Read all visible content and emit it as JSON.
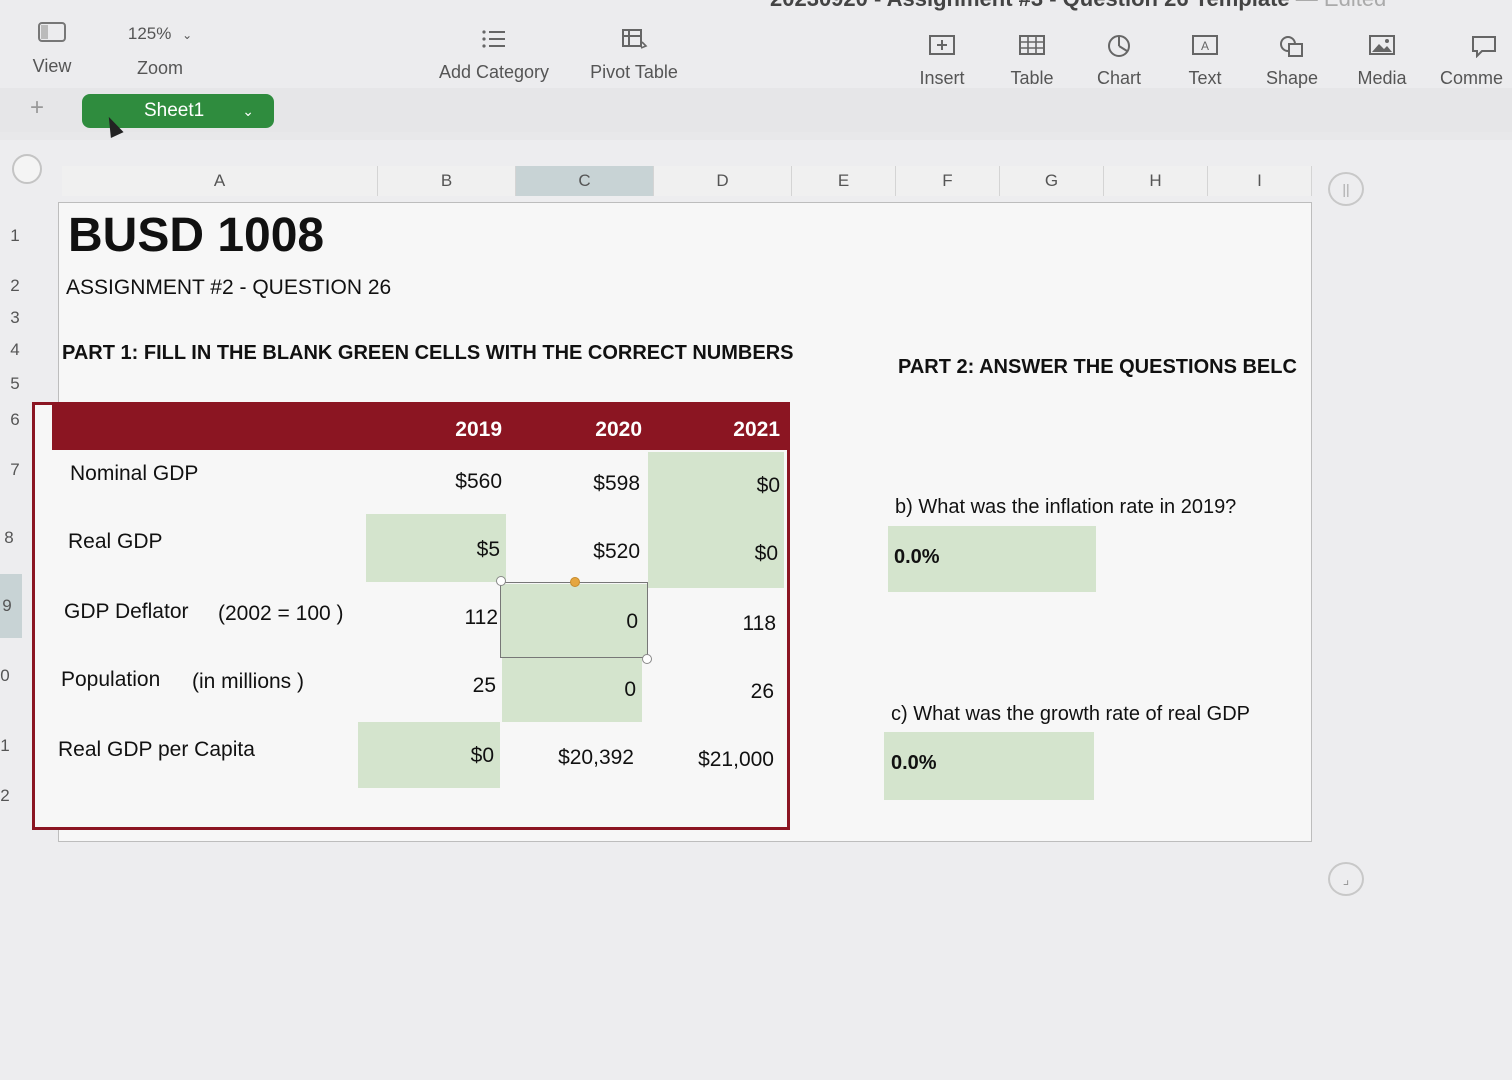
{
  "window": {
    "title": "20230920 - Assignment #3 - Question 26 Template",
    "separator": "—",
    "status": "Edited"
  },
  "toolbar": {
    "view_label": "View",
    "zoom_value": "125%",
    "zoom_label": "Zoom",
    "add_category_label": "Add Category",
    "pivot_table_label": "Pivot Table",
    "insert_label": "Insert",
    "table_label": "Table",
    "chart_label": "Chart",
    "text_label": "Text",
    "shape_label": "Shape",
    "media_label": "Media",
    "comment_label": "Comme"
  },
  "sheets": {
    "add_label": "+",
    "active_tab": "Sheet1"
  },
  "columns": [
    "A",
    "B",
    "C",
    "D",
    "E",
    "F",
    "G",
    "H",
    "I"
  ],
  "rows": [
    "1",
    "2",
    "3",
    "4",
    "5",
    "6",
    "7",
    "8",
    "9",
    "0",
    "1",
    "2"
  ],
  "selected_column": "C",
  "header": {
    "title": "BUSD 1008",
    "subtitle": "ASSIGNMENT #2 - QUESTION 26",
    "part1": "PART 1: FILL IN THE BLANK GREEN CELLS WITH THE CORRECT NUMBERS",
    "part2": "PART 2: ANSWER THE QUESTIONS BELC"
  },
  "table": {
    "years": [
      "2019",
      "2020",
      "2021"
    ],
    "rows": [
      {
        "label": "Nominal GDP",
        "note": "",
        "values": [
          "$560",
          "$598",
          "$0"
        ]
      },
      {
        "label": "Real GDP",
        "note": "",
        "values": [
          "$5",
          "$520",
          "$0"
        ]
      },
      {
        "label": "GDP Deflator",
        "note": "(2002 = 100 )",
        "values": [
          "112",
          "0",
          "118"
        ]
      },
      {
        "label": "Population",
        "note": "(in millions )",
        "values": [
          "25",
          "0",
          "26"
        ]
      },
      {
        "label": "Real GDP per Capita",
        "note": "",
        "values": [
          "$0",
          "$20,392",
          "$21,000"
        ]
      }
    ]
  },
  "questions": {
    "b_text": "b) What was the inflation rate in 2019?",
    "b_answer": "0.0%",
    "c_text": "c) What was the growth rate of real GDP",
    "c_answer": "0.0%"
  },
  "colors": {
    "accent_red": "#8b1522",
    "input_green": "#d4e4cd",
    "sheet_tab_green": "#2f8c3e"
  }
}
